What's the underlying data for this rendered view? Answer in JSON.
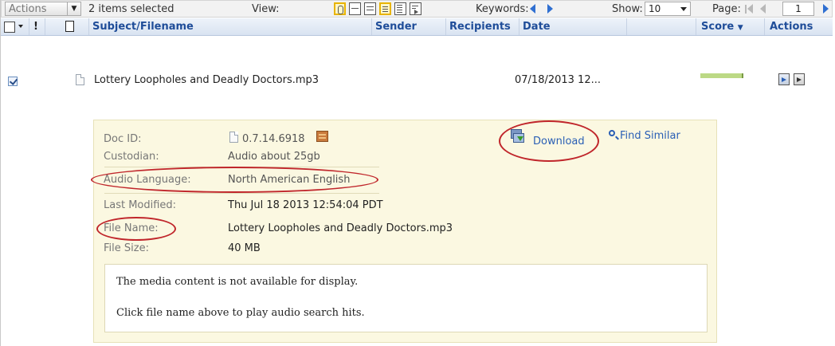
{
  "toolbar": {
    "actions_label": "Actions",
    "selected_count": "2 items selected",
    "view_label": "View:",
    "keywords_label": "Keywords:",
    "show_label": "Show:",
    "show_value": "10",
    "page_label": "Page:",
    "page_value": "1"
  },
  "table": {
    "columns": {
      "flag": "!",
      "subject": "Subject/Filename",
      "sender": "Sender",
      "recipients": "Recipients",
      "date": "Date",
      "score": "Score",
      "actions": "Actions"
    },
    "rows": [
      {
        "checked": true,
        "subject": "Lottery Loopholes and Deadly Doctors.mp3",
        "date": "07/18/2013 12...",
        "score_fraction": 0.55
      }
    ]
  },
  "detail": {
    "doc_id_label": "Doc ID:",
    "doc_id_value": "0.7.14.6918",
    "custodian_label": "Custodian:",
    "custodian_value": "Audio about 25gb",
    "audio_language_label": "Audio Language:",
    "audio_language_value": "North American English",
    "last_modified_label": "Last Modified:",
    "last_modified_value": "Thu Jul 18 2013 12:54:04 PDT",
    "file_name_label": "File Name:",
    "file_name_value": "Lottery Loopholes and Deadly Doctors.mp3",
    "file_size_label": "File Size:",
    "file_size_value": "40 MB",
    "download_label": "Download",
    "find_similar_label": "Find Similar",
    "media_message_1": "The media content is not available for display.",
    "media_message_2": "Click file name above to play audio search hits."
  },
  "colors": {
    "header_text": "#1f4d99",
    "panel_bg": "#fbf8e1",
    "annotation_red": "#c0262b",
    "link_blue": "#2a5fb5",
    "score_green": "#bcd985"
  }
}
